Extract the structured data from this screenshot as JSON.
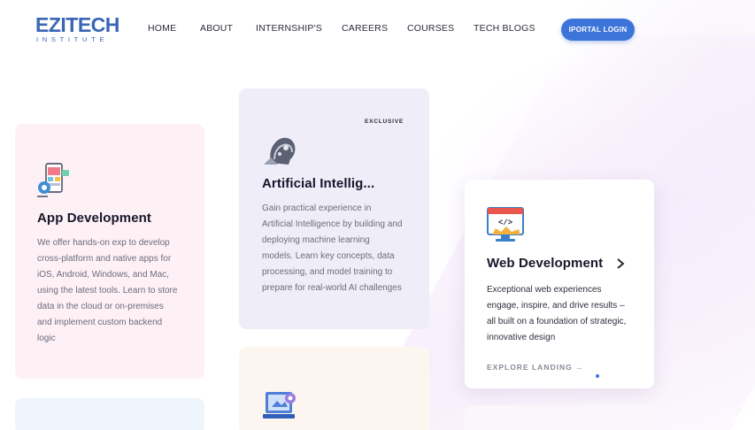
{
  "logo": {
    "main": "EZITECH",
    "sub": "INSTITUTE"
  },
  "nav": {
    "items": [
      "HOME",
      "ABOUT",
      "INTERNSHIP'S",
      "CAREERS",
      "COURSES",
      "TECH BLOGS"
    ],
    "login_label": "IPORTAL LOGIN"
  },
  "cards": {
    "app": {
      "title": "App Development",
      "desc": [
        "We offer hands-on exp to develop",
        "cross-platform and native apps for",
        "iOS, Android, Windows, and Mac,",
        "using the latest tools. Learn to store",
        "data in the cloud or on-premises",
        "and implement custom backend",
        "logic"
      ],
      "icon": "mobile-app-dev-icon"
    },
    "ai": {
      "badge": "EXCLUSIVE",
      "title": "Artificial Intellig...",
      "desc": [
        "Gain practical experience in",
        "Artificial Intelligence by building and",
        "deploying machine learning",
        "models. Learn key concepts, data",
        "processing, and model training to",
        "prepare for real-world AI challenges"
      ],
      "icon": "ai-robot-head-icon"
    },
    "web": {
      "title": "Web Development",
      "desc": [
        "Exceptional web experiences",
        "engage, inspire, and drive results –",
        "all built on a foundation of strategic,",
        "innovative design"
      ],
      "link": "EXPLORE LANDING →",
      "icon": "web-code-monitor-icon"
    },
    "next": {
      "icon": "laptop-settings-icon"
    }
  },
  "colors": {
    "accent": "#3d74d9",
    "brand": "#3a66b6"
  }
}
